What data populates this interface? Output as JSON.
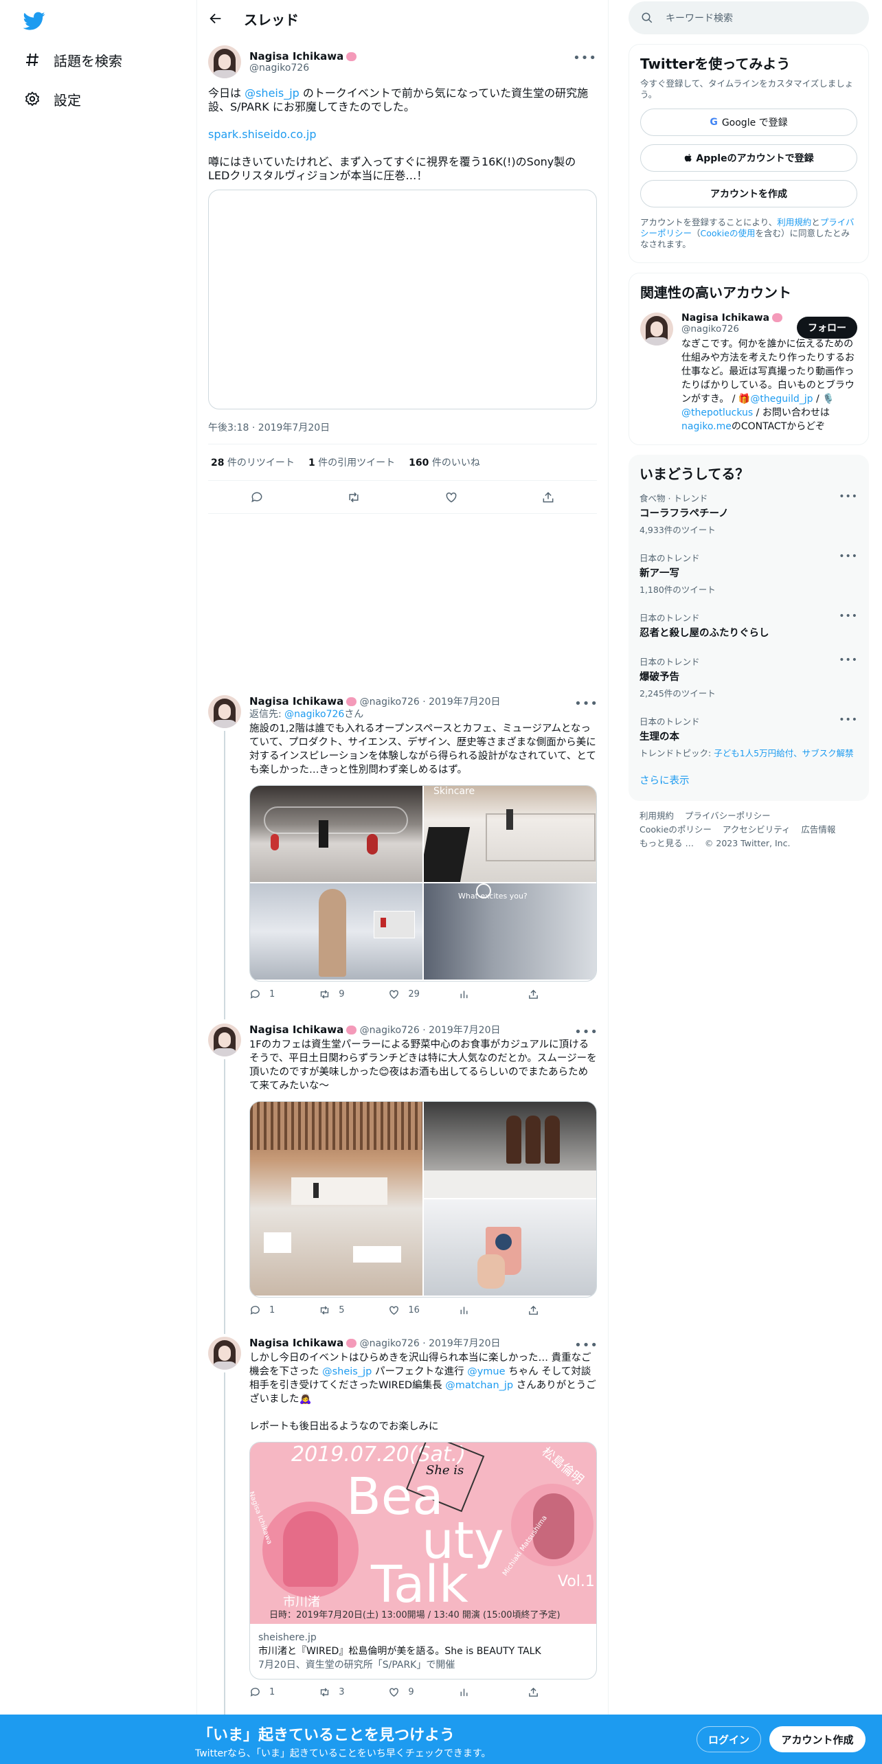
{
  "nav": {
    "explore_label": "話題を検索",
    "settings_label": "設定"
  },
  "header": {
    "title": "スレッド"
  },
  "main_tweet": {
    "name": "Nagisa Ichikawa",
    "handle": "@nagiko726",
    "text_1_prefix": "今日は ",
    "text_1_mention": "@sheis_jp",
    "text_1_suffix": " のトークイベントで前から気になっていた資生堂の研究施設、S/PARK にお邪魔してきたのでした。",
    "link": "spark.shiseido.co.jp",
    "text_2": "噂にはきいていたけれど、まず入ってすぐに視界を覆う16K(!)のSony製のLEDクリスタルヴィジョンが本当に圧巻…！",
    "timestamp": "午後3:18 · 2019年7月20日",
    "retweets_num": "28",
    "retweets_label": " 件のリツイート",
    "quotes_num": "1",
    "quotes_label": " 件の引用ツイート",
    "likes_num": "160",
    "likes_label": " 件のいいね"
  },
  "replies": [
    {
      "name": "Nagisa Ichikawa",
      "meta": "@nagiko726 · 2019年7月20日",
      "reply_to_prefix": "返信先: ",
      "reply_to": "@nagiko726",
      "reply_to_suffix": "さん",
      "text": "施設の1,2階は誰でも入れるオープンスペースとカフェ、ミュージアムとなっていて、プロダクト、サイエンス、デザイン、歴史等さまざまな側面から美に対するインスピレーションを体験しながら得られる設計がなされていて、とても楽しかった…きっと性別問わず楽しめるはず。",
      "photo_text_1": "Skincare",
      "photo_text_2": "What excites you?",
      "replies": "1",
      "retweets": "9",
      "likes": "29"
    },
    {
      "name": "Nagisa Ichikawa",
      "meta": "@nagiko726 · 2019年7月20日",
      "text": "1Fのカフェは資生堂パーラーによる野菜中心のお食事がカジュアルに頂けるそうで、平日土日関わらずランチどきは特に大人気なのだとか。スムージーを頂いたのですが美味しかった😊夜はお酒も出してるらしいのでまたあらためて来てみたいな〜",
      "replies": "1",
      "retweets": "5",
      "likes": "16"
    },
    {
      "name": "Nagisa Ichikawa",
      "meta": "@nagiko726 · 2019年7月20日",
      "text_a": "しかし今日のイベントはひらめきを沢山得られ本当に楽しかった… 貴重なご機会を下さった ",
      "m1": "@sheis_jp",
      "text_b": " パーフェクトな進行 ",
      "m2": "@ymue",
      "text_c": " ちゃん そして対談相手を引き受けてくださったWIRED編集長 ",
      "m3": "@matchan_jp",
      "text_d": " さんありがとうございました🙇‍♀️",
      "text_2": "レポートも後日出るようなのでお楽しみに",
      "card": {
        "poster_date": "2019.07.20(Sat.)",
        "poster_logo": "She is",
        "poster_title_1": "Bea",
        "poster_title_2": "uty",
        "poster_title_3": "Talk",
        "poster_vol": "Vol.1",
        "poster_left_name": "市川渚",
        "poster_right_name": "松島倫明",
        "poster_right_sub": "Michiaki Matsushima",
        "poster_left_sub": "Nagisa Ichikawa",
        "poster_bottom": "日時：2019年7月20日(土) 13:00開場 / 13:40 開演 (15:00頃終了予定)",
        "domain": "sheishere.jp",
        "title": "市川渚と『WIRED』松島倫明が美を語る。She is BEAUTY TALK",
        "desc": "7月20日、資生堂の研究所「S/PARK」で開催"
      },
      "replies": "1",
      "retweets": "3",
      "likes": "9"
    }
  ],
  "right": {
    "search_placeholder": "キーワード検索",
    "signup": {
      "title": "Twitterを使ってみよう",
      "subtitle": "今すぐ登録して、タイムラインをカスタマイズしましょう。",
      "google": "Google で登録",
      "apple": "Appleのアカウントで登録",
      "create": "アカウントを作成",
      "legal_a": "アカウントを登録することにより、",
      "legal_terms": "利用規約",
      "legal_b": "と",
      "legal_privacy": "プライバシーポリシー",
      "legal_c": "（",
      "legal_cookie": "Cookieの使用",
      "legal_d": "を含む）に同意したとみなされます。"
    },
    "related": {
      "title": "関連性の高いアカウント",
      "name": "Nagisa Ichikawa",
      "handle": "@nagiko726",
      "follow": "フォロー",
      "bio_a": "なぎこです。何かを誰かに伝えるための仕組みや方法を考えたり作ったりするお仕事など。最近は写真撮ったり動画作ったりばかりしている。白いものとブラウンがすき。 / 🎁",
      "bio_m1": "@theguild_jp",
      "bio_b": " / 🎙️ ",
      "bio_m2": "@thepotluckus",
      "bio_c": " / お問い合わせは",
      "bio_link": "nagiko.me",
      "bio_d": "のCONTACTからどぞ"
    },
    "trends_title": "いまどうしてる？",
    "trends": [
      {
        "category": "食べ物 · トレンド",
        "name": "コーラフラペチーノ",
        "count": "4,933件のツイート"
      },
      {
        "category": "日本のトレンド",
        "name": "新ア一写",
        "count": "1,180件のツイート"
      },
      {
        "category": "日本のトレンド",
        "name": "忍者と殺し屋のふたりぐらし",
        "count": ""
      },
      {
        "category": "日本のトレンド",
        "name": "爆破予告",
        "count": "2,245件のツイート"
      },
      {
        "category": "日本のトレンド",
        "name": "生理の本",
        "count": "",
        "topic_label": "トレンドトピック: ",
        "topic": "子ども1人5万円給付、サブスク解禁"
      }
    ],
    "show_more": "さらに表示",
    "footer": {
      "terms": "利用規約",
      "privacy": "プライバシーポリシー",
      "cookie": "Cookieのポリシー",
      "accessibility": "アクセシビリティ",
      "ads": "広告情報",
      "more": "もっと見る …",
      "copyright": "© 2023 Twitter, Inc."
    }
  },
  "bottom_bar": {
    "title": "「いま」起きていることを見つけよう",
    "subtitle": "Twitterなら、「いま」起きていることをいち早くチェックできます。",
    "login": "ログイン",
    "signup": "アカウント作成"
  },
  "colors": {
    "accent": "#1d9bf0",
    "text": "#0f1419",
    "muted": "#536471",
    "border": "#eff3f4"
  }
}
